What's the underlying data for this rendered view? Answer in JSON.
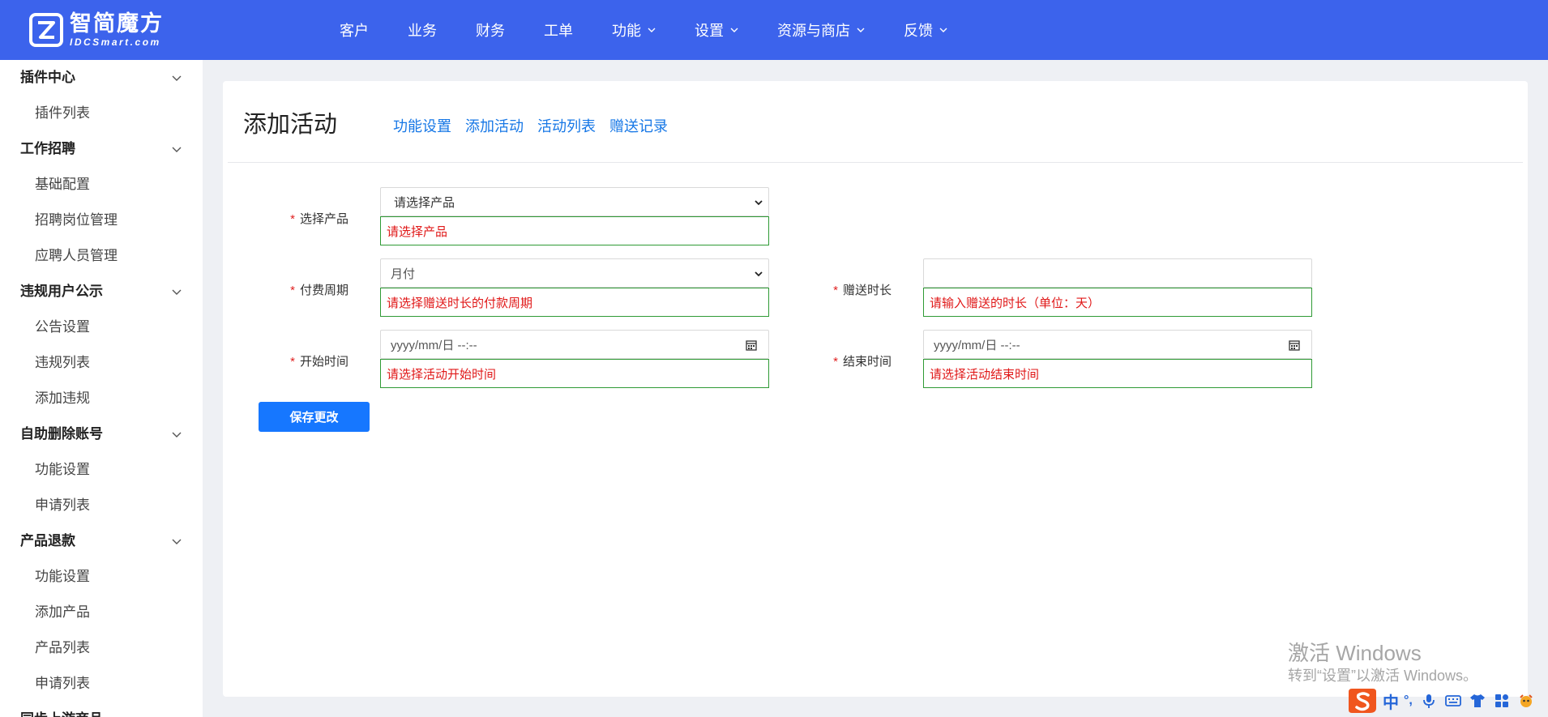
{
  "brand": {
    "name_cn": "智简魔方",
    "name_en": "IDCSmart.com"
  },
  "nav": [
    {
      "label": "客户",
      "dropdown": false
    },
    {
      "label": "业务",
      "dropdown": false
    },
    {
      "label": "财务",
      "dropdown": false
    },
    {
      "label": "工单",
      "dropdown": false
    },
    {
      "label": "功能",
      "dropdown": true
    },
    {
      "label": "设置",
      "dropdown": true
    },
    {
      "label": "资源与商店",
      "dropdown": true
    },
    {
      "label": "反馈",
      "dropdown": true
    }
  ],
  "sidebar": {
    "groups": [
      {
        "label": "插件中心",
        "items": [
          "插件列表"
        ]
      },
      {
        "label": "工作招聘",
        "items": [
          "基础配置",
          "招聘岗位管理",
          "应聘人员管理"
        ]
      },
      {
        "label": "违规用户公示",
        "items": [
          "公告设置",
          "违规列表",
          "添加违规"
        ]
      },
      {
        "label": "自助删除账号",
        "items": [
          "功能设置",
          "申请列表"
        ]
      },
      {
        "label": "产品退款",
        "items": [
          "功能设置",
          "添加产品",
          "产品列表",
          "申请列表"
        ]
      },
      {
        "label": "同步上游商品",
        "items": []
      }
    ]
  },
  "page": {
    "title": "添加活动",
    "tabs": [
      "功能设置",
      "添加活动",
      "活动列表",
      "赠送记录"
    ]
  },
  "form": {
    "product": {
      "label": "选择产品",
      "value": "请选择产品",
      "error": "请选择产品"
    },
    "cycle": {
      "label": "付费周期",
      "value": "月付",
      "error": "请选择赠送时长的付款周期"
    },
    "duration": {
      "label": "赠送时长",
      "value": "",
      "error": "请输入赠送的时长（单位：天）"
    },
    "start": {
      "label": "开始时间",
      "placeholder": "yyyy/mm/日 --:--",
      "error": "请选择活动开始时间"
    },
    "end": {
      "label": "结束时间",
      "placeholder": "yyyy/mm/日 --:--",
      "error": "请选择活动结束时间"
    },
    "required_mark": "*",
    "save_label": "保存更改"
  },
  "watermark": {
    "line1": "激活 Windows",
    "line2": "转到“设置”以激活 Windows。"
  },
  "ime": {
    "mode": "中",
    "punct": "°,"
  },
  "colors": {
    "topbar": "#3c63ec",
    "link": "#1677e6",
    "button": "#1677ff",
    "error_text": "#e01818",
    "error_border": "#2f9a35"
  }
}
